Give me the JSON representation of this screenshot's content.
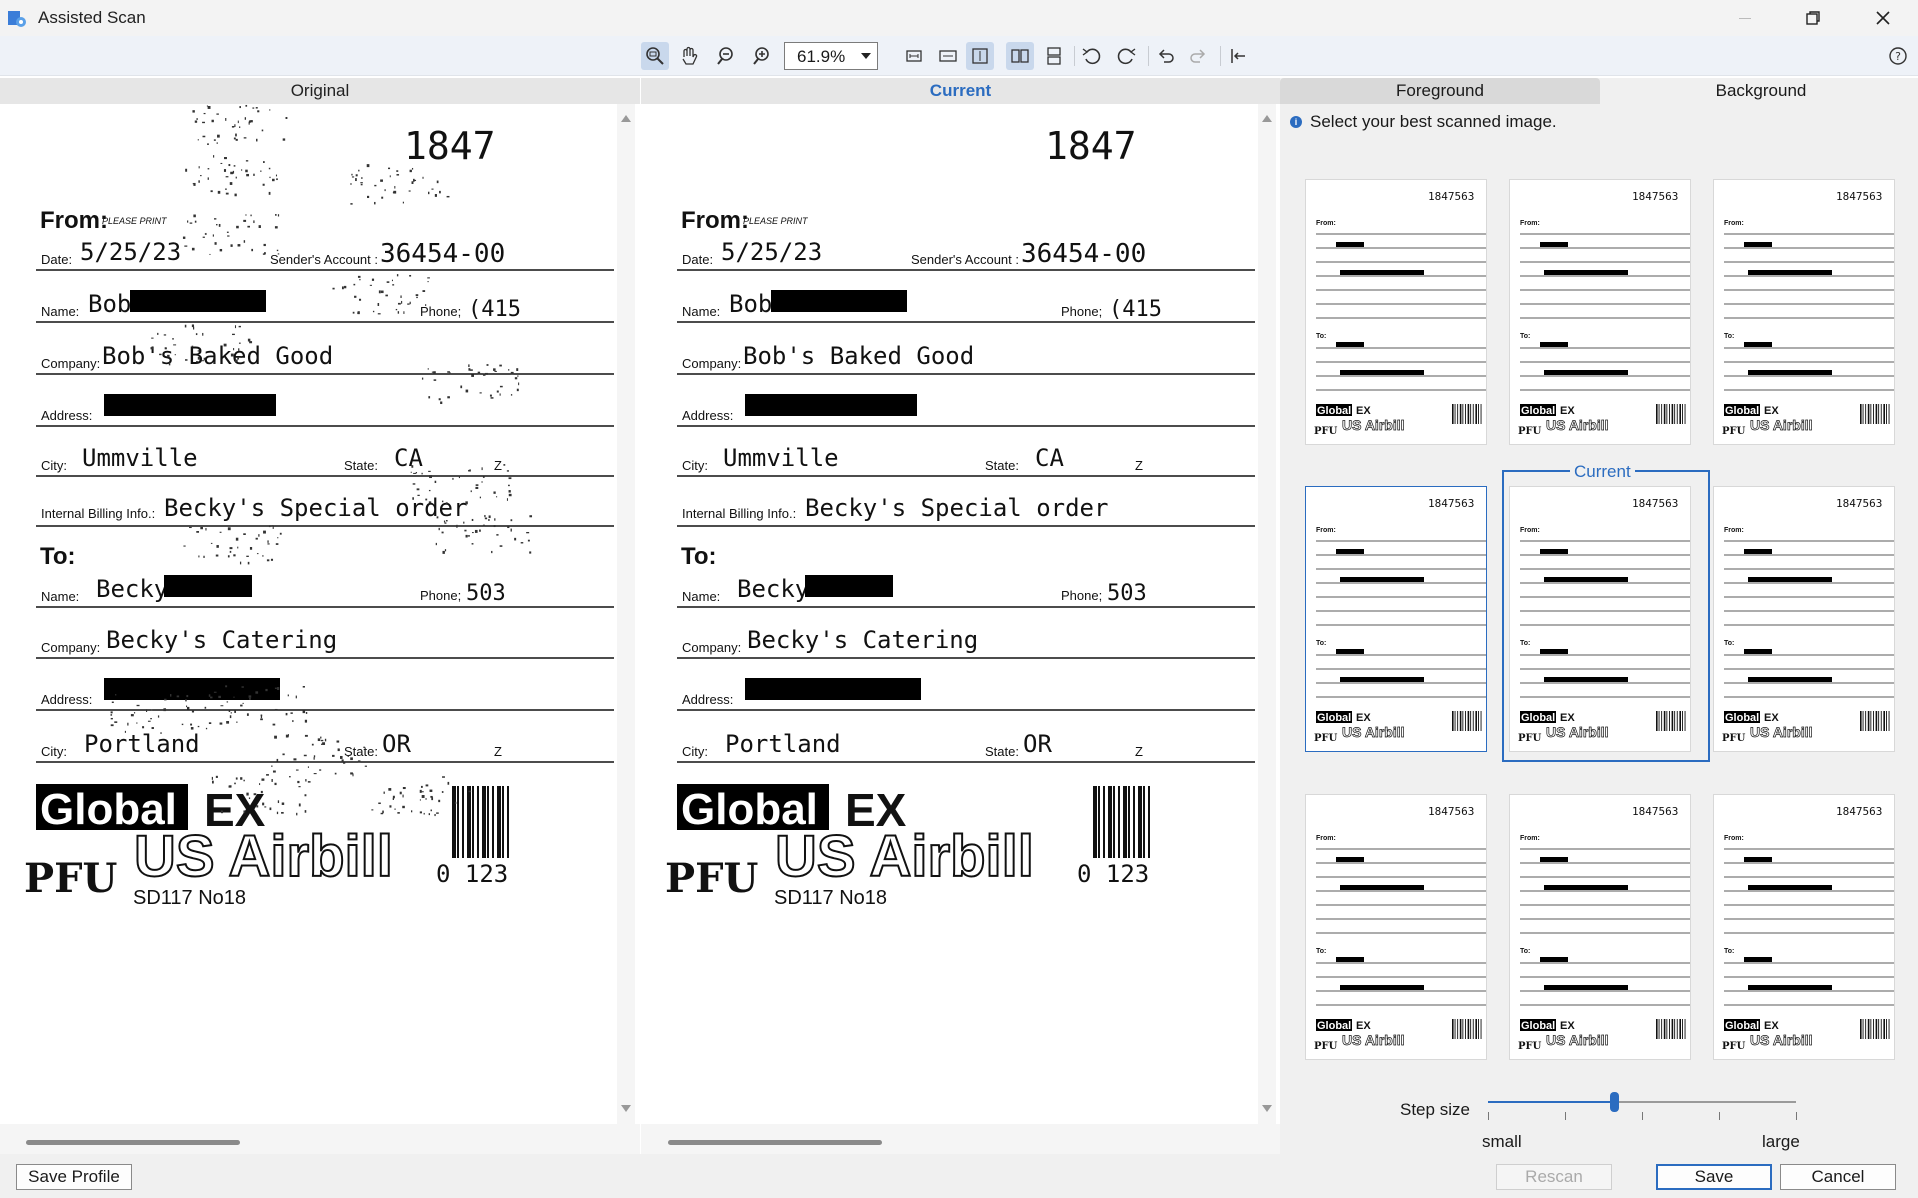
{
  "window": {
    "title": "Assisted Scan"
  },
  "toolbar": {
    "zoom": "61.9%"
  },
  "panes": {
    "original": "Original",
    "current": "Current"
  },
  "tabs": {
    "foreground": "Foreground",
    "background": "Background"
  },
  "info_text": "Select your best scanned image.",
  "current_label": "Current",
  "step": {
    "label": "Step size",
    "small": "small",
    "large": "large",
    "value_fraction": 0.41
  },
  "buttons": {
    "save_profile": "Save Profile",
    "rescan": "Rescan",
    "save": "Save",
    "cancel": "Cancel"
  },
  "colors": {
    "accent": "#2b6cc0"
  },
  "scan": {
    "tracking": "1847",
    "thumb_tracking": "1847563",
    "from": "From:",
    "please_print": "PLEASE PRINT",
    "date_label": "Date:",
    "date": "5/25/23",
    "account_label": "Sender's Account :",
    "account": "36454-00",
    "name_label": "Name:",
    "from_name": "Bob",
    "phone_label": "Phone;",
    "from_phone": "(415",
    "company_label": "Company:",
    "from_company": "Bob's Baked Good",
    "address_label": "Address:",
    "city_label": "City:",
    "from_city": "Ummville",
    "state_label": "State:",
    "from_state": "CA",
    "z": "Z",
    "billing_label": "Internal Billing Info.:",
    "billing": "Becky's Special order",
    "to": "To:",
    "to_name": "Becky",
    "to_phone": "503",
    "to_company": "Becky's Catering",
    "to_city": "Portland",
    "to_state": "OR",
    "brand1": "Global",
    "brand2": "EX",
    "brand3": "US Airbill",
    "pfu": "PFU",
    "form": "SD117 No18",
    "barcode_num": "0 123"
  }
}
